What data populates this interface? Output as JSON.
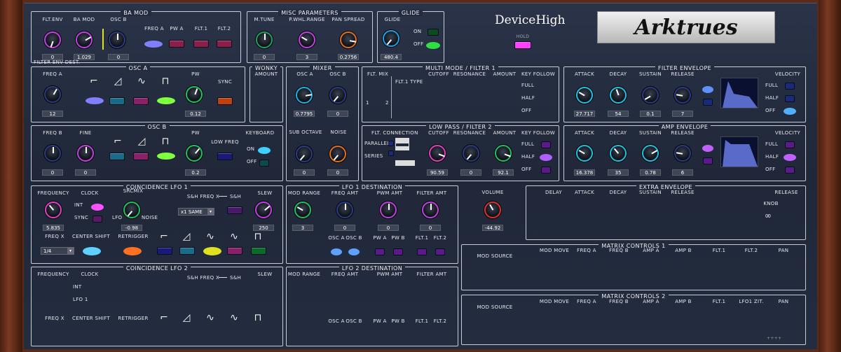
{
  "brand": {
    "device": "DeviceHigh",
    "logo": "Arktrues",
    "hold": "HOLD"
  },
  "ba_mod": {
    "title": "BA MOD",
    "flt_env": "FLT.ENV",
    "ba_mod": "BA MOD",
    "osc_b": "OSC B",
    "freq_a": "FREQ A",
    "pw_a": "PW A",
    "flt1": "FLT.1",
    "flt2": "FLT.2",
    "v1": "0",
    "v2": "1.029",
    "v3": "0",
    "sub": "FILTER ENV DEST."
  },
  "misc": {
    "title": "MISC PARAMETERS",
    "mtune": "M.TUNE",
    "pwhl": "P.WHL.RANGE",
    "pan": "PAN SPREAD",
    "v1": "0",
    "v2": "3",
    "v3": "0.2756"
  },
  "glide": {
    "title": "GLIDE",
    "knob": "GLIDE",
    "on": "ON",
    "off": "OFF",
    "v": "480.4"
  },
  "osc_a": {
    "title": "OSC A",
    "freq": "FREQ A",
    "pw": "PW",
    "sync": "SYNC",
    "v1": "12",
    "v2": "0.12"
  },
  "wonky": {
    "title": "WONKY",
    "amount": "AMOUNT"
  },
  "mixer": {
    "title": "MIXER",
    "osc_a": "OSC A",
    "osc_b": "OSC B",
    "sub": "SUB OCTAVE",
    "noise": "NOISE",
    "v1": "0.7795",
    "v2": "0",
    "v3": "0",
    "v4": "0"
  },
  "osc_b": {
    "title": "OSC B",
    "freq": "FREQ B",
    "fine": "FINE",
    "pw": "PW",
    "lowfreq": "LOW FREQ",
    "kbd": "KEYBOARD",
    "on": "ON",
    "off": "OFF",
    "v1": "0",
    "v2": "0",
    "v3": "0.2"
  },
  "filter1": {
    "title": "MULTI MODE / FILTER 1",
    "mix": "FLT. MIX",
    "type": "FLT.1 TYPE",
    "cutoff": "CUTOFF",
    "res": "RESONANCE",
    "amount": "AMOUNT",
    "kf": "KEY FOLLOW",
    "full": "FULL",
    "half": "HALF",
    "off": "OFF",
    "n1": "1",
    "n2": "2"
  },
  "filter2": {
    "title": "LOW PASS / FILTER 2",
    "conn": "FLT. CONNECTION",
    "parallel": "PARALLEL",
    "series": "SERIES",
    "cutoff": "CUTOFF",
    "res": "RESONANCE",
    "amount": "AMOUNT",
    "kf": "KEY FOLLOW",
    "full": "FULL",
    "half": "HALF",
    "off": "OFF",
    "v1": "90.59",
    "v2": "0",
    "v3": "92.1"
  },
  "fenv": {
    "title": "FILTER ENVELOPE",
    "a": "ATTACK",
    "d": "DECAY",
    "s": "SUSTAIN",
    "r": "RELEASE",
    "vel": "VELOCITY",
    "full": "FULL",
    "half": "HALF",
    "off": "OFF",
    "v1": "27.717",
    "v2": "54",
    "v3": "0.1",
    "v4": "7"
  },
  "aenv": {
    "title": "AMP ENVELOPE",
    "a": "ATTACK",
    "d": "DECAY",
    "s": "SUSTAIN",
    "r": "RELEASE",
    "vel": "VELOCITY",
    "full": "FULL",
    "half": "HALF",
    "off": "OFF",
    "v1": "16.378",
    "v2": "35",
    "v3": "0.78",
    "v4": "6"
  },
  "lfo1": {
    "title": "COINCIDENCE LFO 1",
    "freq": "FREQUENCY",
    "clock": "CLOCK",
    "srcmix": "SRCMIX",
    "int": "INT",
    "sync": "SYNC",
    "lfo": "LFO",
    "noise": "NOISE",
    "sh": "S&H FREQ X",
    "sh2": "S&H",
    "slew": "SLEW",
    "same": "x1 SAME",
    "freqx": "FREQ X",
    "center": "CENTER SHIFT",
    "retrig": "RETRIGGER",
    "fsel": "1/4",
    "v1": "5.835",
    "v2": "-0.98",
    "v3": "250"
  },
  "lfo1d": {
    "title": "LFO 1 DESTINATION",
    "range": "MOD RANGE",
    "freq": "FREQ AMT",
    "pwm": "PWM AMT",
    "filt": "FILTER AMT",
    "osca": "OSC A",
    "oscb": "OSC B",
    "pwa": "PW A",
    "pwb": "PW B",
    "f1": "FLT.1",
    "f2": "FLT.2",
    "v1": "3",
    "v2": "0",
    "v3": "0",
    "v4": "0"
  },
  "volume": {
    "label": "VOLUME",
    "v": "-44.92"
  },
  "xenv": {
    "title": "EXTRA ENVELOPE",
    "delay": "DELAY",
    "a": "ATTACK",
    "d": "DECAY",
    "s": "SUSTAIN",
    "r": "RELEASE",
    "rel": "RELEASE",
    "knob": "KNOB",
    "inf": "∞"
  },
  "lfo2": {
    "title": "COINCIDENCE LFO 2",
    "freq": "FREQUENCY",
    "clock": "CLOCK",
    "int": "INT",
    "lfo1": "LFO 1",
    "sh": "S&H FREQ X",
    "sh2": "S&H",
    "slew": "SLEW",
    "freqx": "FREQ X",
    "center": "CENTER SHIFT",
    "retrig": "RETRIGGER"
  },
  "lfo2d": {
    "title": "LFO 2 DESTINATION",
    "range": "MOD RANGE",
    "freq": "FREQ AMT",
    "pwm": "PWM AMT",
    "filt": "FILTER AMT",
    "osca": "OSC A",
    "oscb": "OSC B",
    "pwa": "PW A",
    "pwb": "PW B",
    "f1": "FLT.1",
    "f2": "FLT.2"
  },
  "mx1": {
    "title": "MATRIX CONTROLS 1",
    "src": "MOD SOURCE",
    "c1": "MOD MOVE",
    "c2": "FREQ A",
    "c3": "FREQ B",
    "c4": "AMP A",
    "c5": "AMP B",
    "c6": "FLT.1",
    "c7": "FLT.2",
    "c8": "PAN"
  },
  "mx2": {
    "title": "MATRIX CONTROLS 2",
    "src": "MOD SOURCE",
    "c1": "MOD MOVE",
    "c2": "FREQ A",
    "c3": "FREQ B",
    "c4": "AMP A",
    "c5": "AMP B",
    "c6": "FLT.1",
    "c7": "LFO1 ZIT.",
    "c8": "PAN"
  },
  "footer": "++++"
}
